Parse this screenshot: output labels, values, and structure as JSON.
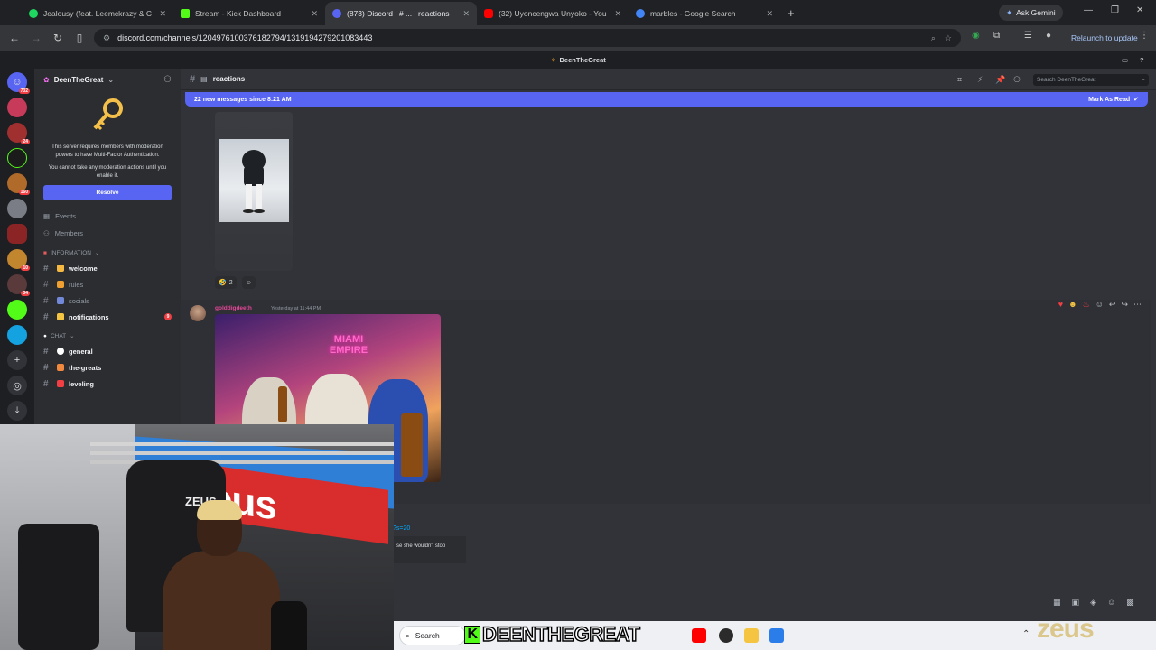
{
  "browser": {
    "tabs": [
      {
        "title": "Jealousy (feat. Leemckrazy & C",
        "color": "#1ed760"
      },
      {
        "title": "Stream - Kick Dashboard",
        "color": "#53fc18"
      },
      {
        "title": "(873) Discord | # ... | reactions",
        "color": "#5865f2"
      },
      {
        "title": "(32) Uyoncengwa Unyoko - You",
        "color": "#ff0000"
      },
      {
        "title": "marbles - Google Search",
        "color": "#4285f4"
      }
    ],
    "new_tab": "+",
    "gemini_label": "Ask Gemini",
    "url": "discord.com/channels/1204976100376182794/1319194279201083443",
    "relaunch_label": "Relaunch to update"
  },
  "discord": {
    "top_title": "DeenTheGreat",
    "server_badges": [
      "732",
      "24",
      "160",
      "10",
      "34"
    ],
    "server": {
      "name": "DeenTheGreat",
      "mfa_message": "This server requires members with moderation powers to have Multi-Factor Authentication.",
      "mfa_note": "You cannot take any moderation actions until you enable it.",
      "resolve_label": "Resolve",
      "nav": [
        {
          "label": "Events",
          "icon": "calendar-icon"
        },
        {
          "label": "Members",
          "icon": "members-icon"
        }
      ],
      "categories": [
        {
          "name": "INFORMATION",
          "channels": [
            {
              "label": "welcome",
              "emoji_color": "#f5b942",
              "bright": true
            },
            {
              "label": "rules",
              "emoji_color": "#f0a030",
              "bright": false
            },
            {
              "label": "socials",
              "emoji_color": "#7289da",
              "bright": false
            },
            {
              "label": "notifications",
              "emoji_color": "#f5c542",
              "bright": true,
              "badge": "9"
            }
          ]
        },
        {
          "name": "CHAT",
          "channels": [
            {
              "label": "general",
              "emoji_color": "#ffffff",
              "bright": true
            },
            {
              "label": "the-greats",
              "emoji_color": "#f0883e",
              "bright": true
            },
            {
              "label": "leveling",
              "emoji_color": "#f23f43",
              "bright": true
            }
          ]
        }
      ]
    },
    "channel": {
      "name": "reactions",
      "search_placeholder": "Search DeenTheGreat",
      "new_messages": "22 new messages since 8:21 AM",
      "mark_read": "Mark As Read"
    },
    "messages": [
      {
        "reactions": [
          {
            "emoji": "🤣",
            "count": "2"
          }
        ]
      },
      {
        "author": "golddigdeeth",
        "timestamp": "Yesterday at 11:44 PM",
        "image_text": "MIAMI EMPIRE"
      }
    ],
    "link_fragment": "?s=20",
    "quote_fragment": "se she wouldn't stop"
  },
  "overlay": {
    "banner_text": "zeus",
    "chair_text": "ZEUS",
    "streamer_name": "DEENTHEGREAT",
    "kick_letter": "K",
    "watermark": "zeus"
  },
  "taskbar": {
    "search_label": "Search"
  }
}
